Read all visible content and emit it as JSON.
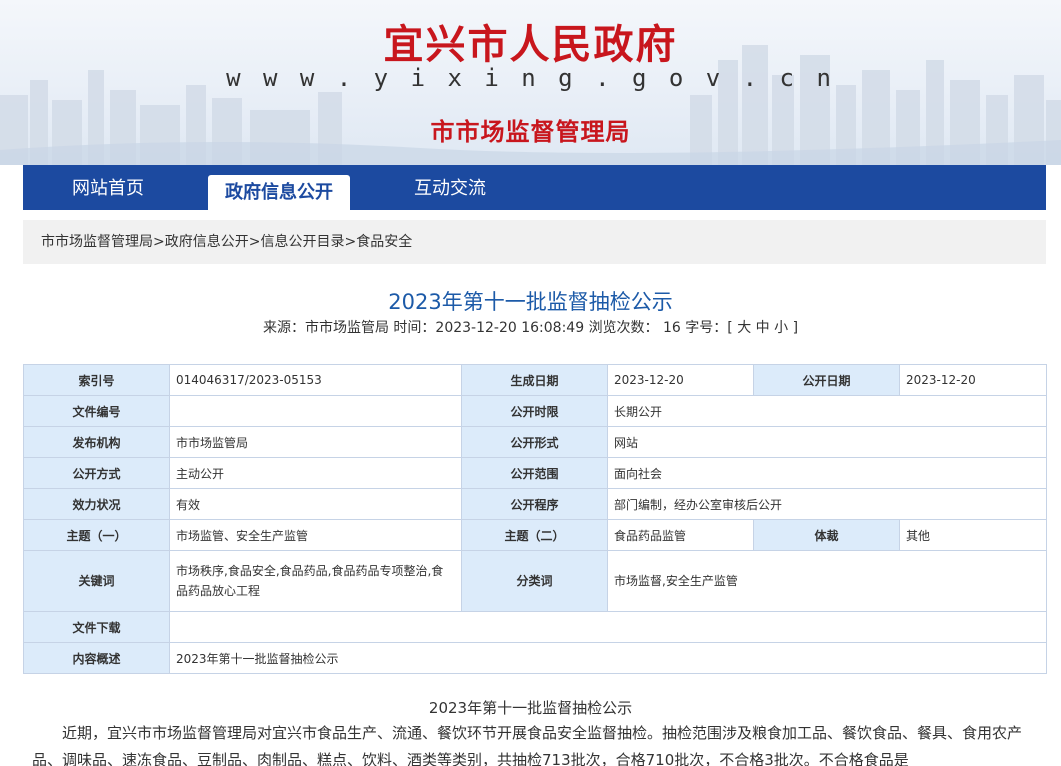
{
  "header": {
    "site_title": "宜兴市人民政府",
    "site_url": "w w w . y i x i n g . g o v . c n",
    "department": "市市场监督管理局"
  },
  "nav": {
    "items": [
      {
        "label": "网站首页"
      },
      {
        "label": "政府信息公开"
      },
      {
        "label": "互动交流"
      }
    ],
    "active_index": 1
  },
  "breadcrumb": {
    "items": [
      "市市场监督管理局",
      "政府信息公开",
      "信息公开目录",
      "食品安全"
    ],
    "separator": ">"
  },
  "article": {
    "title": "2023年第十一批监督抽检公示",
    "meta": {
      "source_label": "来源：",
      "source": "市市场监管局",
      "time_label": "时间：",
      "time": "2023-12-20 16:08:49",
      "views_label": "浏览次数：",
      "views": "16",
      "fontsize_label": "字号：",
      "fontsize_open": "[",
      "fontsize_large": "大",
      "fontsize_medium": "中",
      "fontsize_small": "小",
      "fontsize_close": "]"
    }
  },
  "info_table": {
    "index_no_label": "索引号",
    "index_no": "014046317/2023-05153",
    "gen_date_label": "生成日期",
    "gen_date": "2023-12-20",
    "pub_date_label": "公开日期",
    "pub_date": "2023-12-20",
    "doc_no_label": "文件编号",
    "doc_no": "",
    "pub_period_label": "公开时限",
    "pub_period": "长期公开",
    "issuer_label": "发布机构",
    "issuer": "市市场监管局",
    "pub_form_label": "公开形式",
    "pub_form": "网站",
    "pub_method_label": "公开方式",
    "pub_method": "主动公开",
    "pub_scope_label": "公开范围",
    "pub_scope": "面向社会",
    "validity_label": "效力状况",
    "validity": "有效",
    "pub_procedure_label": "公开程序",
    "pub_procedure": "部门编制，经办公室审核后公开",
    "topic1_label": "主题（一）",
    "topic1": "市场监管、安全生产监管",
    "topic2_label": "主题（二）",
    "topic2": "食品药品监管",
    "genre_label": "体裁",
    "genre": "其他",
    "keywords_label": "关键词",
    "keywords": "市场秩序,食品安全,食品药品,食品药品专项整治,食品药品放心工程",
    "category_label": "分类词",
    "category": "市场监督,安全生产监管",
    "download_label": "文件下载",
    "download": "",
    "summary_label": "内容概述",
    "summary": "2023年第十一批监督抽检公示"
  },
  "body": {
    "title": "2023年第十一批监督抽检公示",
    "paragraph": "近期，宜兴市市场监督管理局对宜兴市食品生产、流通、餐饮环节开展食品安全监督抽检。抽检范围涉及粮食加工品、餐饮食品、餐具、食用农产品、调味品、速冻食品、豆制品、肉制品、糕点、饮料、酒类等类别，共抽检713批次，合格710批次，不合格3批次。不合格食品是"
  },
  "colors": {
    "brand_red": "#c8161d",
    "nav_blue": "#1c4aa0",
    "title_blue": "#1c5aa8",
    "table_key_bg": "#dcebfa",
    "table_border": "#c6d3e6"
  }
}
